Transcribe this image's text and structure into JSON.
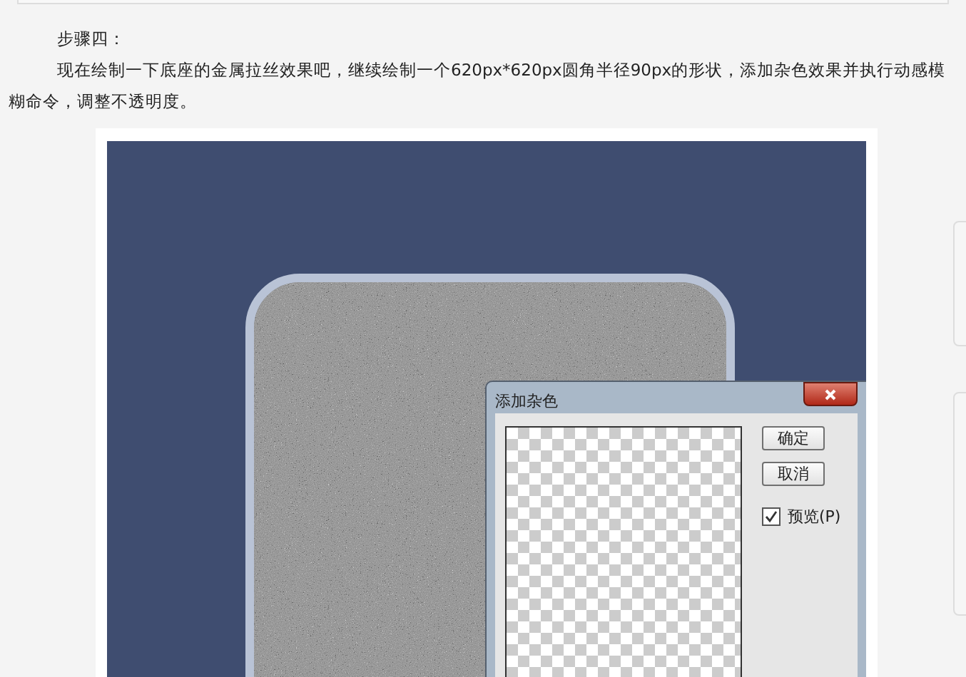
{
  "article": {
    "heading": "步骤四：",
    "paragraph": "现在绘制一下底座的金属拉丝效果吧，继续绘制一个620px*620px圆角半径90px的形状，添加杂色效果并执行动感模糊命令，调整不透明度。"
  },
  "dialog": {
    "title": "添加杂色",
    "buttons": [
      "确定",
      "取消"
    ],
    "preview": {
      "label": "预览(P)",
      "checked": true
    }
  }
}
